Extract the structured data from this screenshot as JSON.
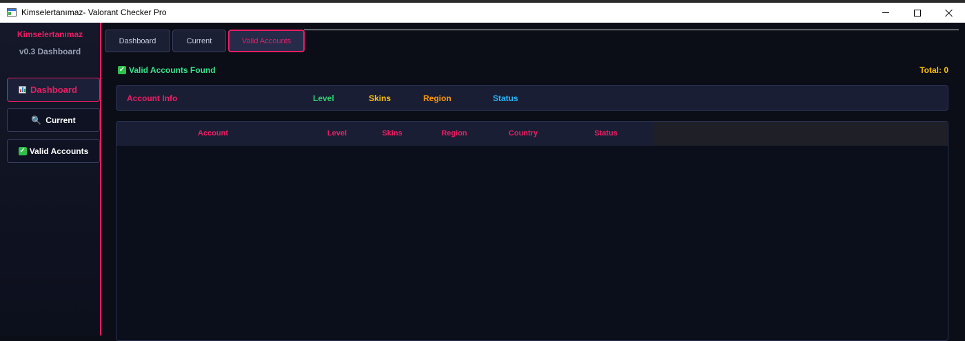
{
  "window": {
    "title": "Kimselertanımaz- Valorant Checker Pro"
  },
  "sidebar": {
    "brand": "Kimselertanımaz",
    "version": "v0.3 Dashboard",
    "items": [
      {
        "label": "Dashboard",
        "icon": "chart-icon",
        "active": true
      },
      {
        "label": "Current",
        "icon": "search-icon",
        "active": false
      },
      {
        "label": "Valid Accounts",
        "icon": "check-icon",
        "active": false
      }
    ]
  },
  "tabs": [
    {
      "label": "Dashboard",
      "active": false
    },
    {
      "label": "Current",
      "active": false
    },
    {
      "label": "Valid Accounts",
      "active": true
    }
  ],
  "status": {
    "found_label": "Valid Accounts Found",
    "total_label": "Total: 0"
  },
  "summary_bar": {
    "account_info": "Account Info",
    "level": "Level",
    "skins": "Skins",
    "region": "Region",
    "status": "Status"
  },
  "table": {
    "columns": [
      "Account",
      "Level",
      "Skins",
      "Region",
      "Country",
      "Status"
    ],
    "rows": []
  },
  "colors": {
    "accent": "#e91e63",
    "level": "#2ecc71",
    "skins": "#ffc107",
    "region": "#ff9800",
    "status": "#29b6f6",
    "found": "#39e58c",
    "total": "#ffc107"
  }
}
